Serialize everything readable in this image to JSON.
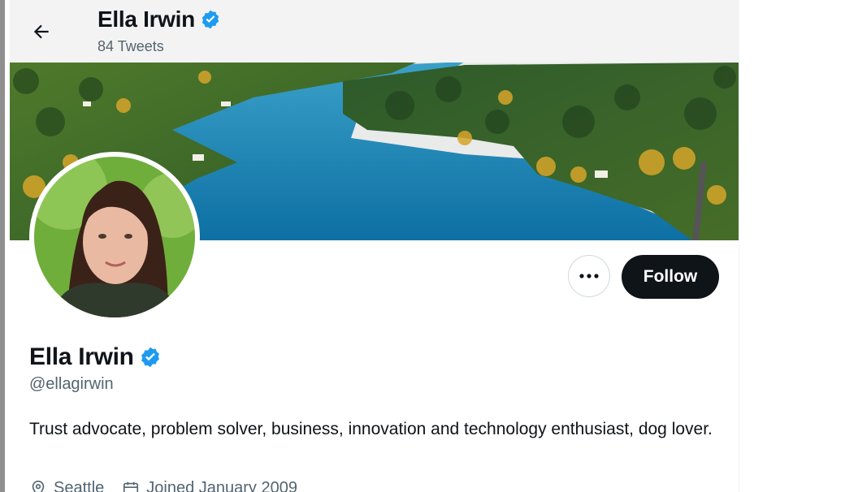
{
  "header": {
    "back_label": "Back",
    "title": "Ella Irwin",
    "tweet_count": "84 Tweets"
  },
  "profile": {
    "name": "Ella Irwin",
    "handle": "@ellagirwin",
    "bio": "Trust advocate, problem solver, business, innovation and technology enthusiast, dog lover.",
    "location": "Seattle",
    "joined": "Joined January 2009",
    "verified": true
  },
  "actions": {
    "follow_label": "Follow",
    "more_label": "More"
  },
  "colors": {
    "verified_blue": "#1d9bf0",
    "follow_bg": "#0f1419",
    "secondary_text": "#536471"
  },
  "icons": [
    "arrow-left-icon",
    "verified-badge-icon",
    "more-dots-icon",
    "location-pin-icon",
    "calendar-icon"
  ]
}
